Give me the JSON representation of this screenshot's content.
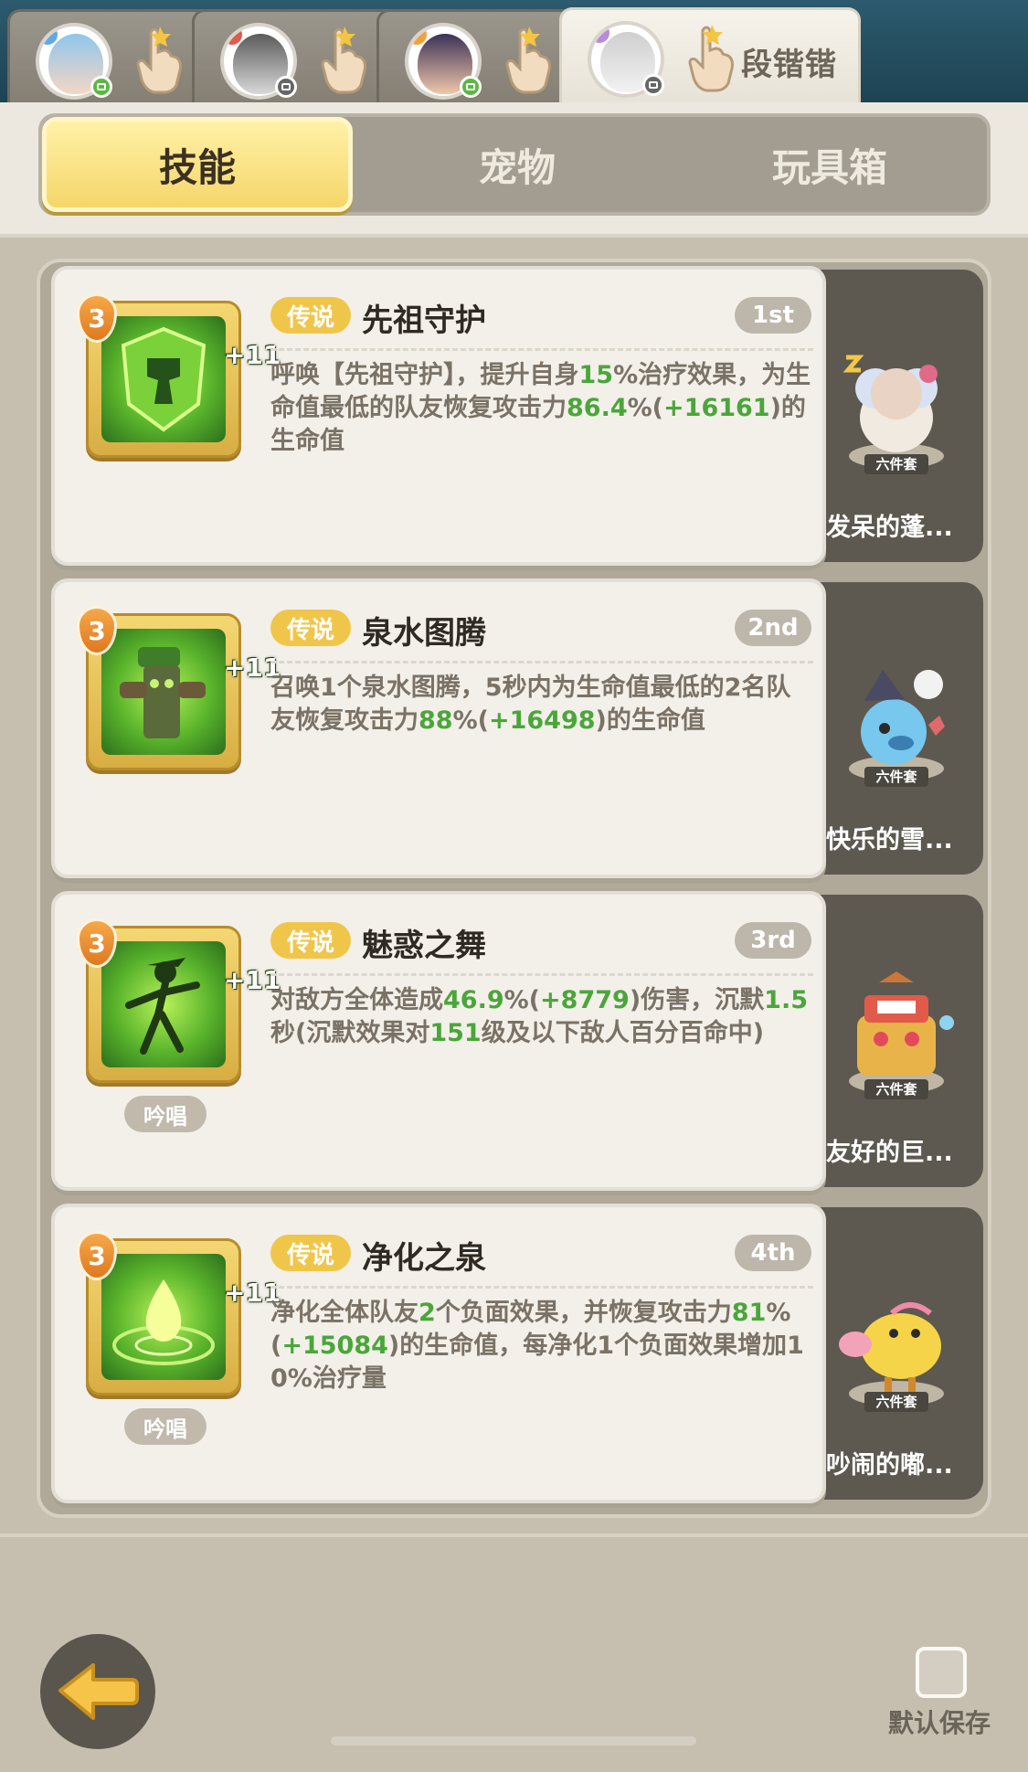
{
  "hero_tabs": [
    {
      "name": "",
      "active": false
    },
    {
      "name": "",
      "active": false
    },
    {
      "name": "",
      "active": false
    },
    {
      "name": "段锴锴",
      "active": true
    }
  ],
  "category_tabs": [
    {
      "label": "技能",
      "active": true
    },
    {
      "label": "宠物",
      "active": false
    },
    {
      "label": "玩具箱",
      "active": false
    }
  ],
  "skills": [
    {
      "level": "3",
      "plus": "+11",
      "rarity": "传说",
      "name": "先祖守护",
      "order": "1st",
      "chant": "",
      "desc": [
        {
          "t": "呼唤【先祖守护】，提升自身"
        },
        {
          "t": "15",
          "hl": true
        },
        {
          "t": "%治疗效果，为生命值最低的队友恢复攻击力"
        },
        {
          "t": "86.4",
          "hl": true
        },
        {
          "t": "%("
        },
        {
          "t": "+16161",
          "hl": true
        },
        {
          "t": ")的生命值"
        }
      ],
      "pet": {
        "set": "六件套",
        "name": "发呆的蓬..."
      }
    },
    {
      "level": "3",
      "plus": "+11",
      "rarity": "传说",
      "name": "泉水图腾",
      "order": "2nd",
      "chant": "",
      "desc": [
        {
          "t": "召唤1个泉水图腾，5秒内为生命值最低的2名队友恢复攻击力"
        },
        {
          "t": "88",
          "hl": true
        },
        {
          "t": "%("
        },
        {
          "t": "+16498",
          "hl": true
        },
        {
          "t": ")的生命值"
        }
      ],
      "pet": {
        "set": "六件套",
        "name": "快乐的雪..."
      }
    },
    {
      "level": "3",
      "plus": "+11",
      "rarity": "传说",
      "name": "魅惑之舞",
      "order": "3rd",
      "chant": "吟唱",
      "desc": [
        {
          "t": "对敌方全体造成"
        },
        {
          "t": "46.9",
          "hl": true
        },
        {
          "t": "%("
        },
        {
          "t": "+8779",
          "hl": true
        },
        {
          "t": ")伤害，沉默"
        },
        {
          "t": "1.5",
          "hl": true
        },
        {
          "t": "秒(沉默效果对"
        },
        {
          "t": "151",
          "hl": true
        },
        {
          "t": "级及以下敌人百分百命中)"
        }
      ],
      "pet": {
        "set": "六件套",
        "name": "友好的巨..."
      }
    },
    {
      "level": "3",
      "plus": "+11",
      "rarity": "传说",
      "name": "净化之泉",
      "order": "4th",
      "chant": "吟唱",
      "desc": [
        {
          "t": "净化全体队友"
        },
        {
          "t": "2",
          "hl": true
        },
        {
          "t": "个负面效果，并恢复攻击力"
        },
        {
          "t": "81",
          "hl": true
        },
        {
          "t": "%("
        },
        {
          "t": "+15084",
          "hl": true
        },
        {
          "t": ")的生命值，每净化1个负面效果增加10%治疗量"
        }
      ],
      "pet": {
        "set": "六件套",
        "name": "吵闹的嘟..."
      }
    }
  ],
  "bottom": {
    "save_label": "默认保存"
  },
  "colors": {
    "highlight": "#4aa63a",
    "rarity_bg": "#f0c64a",
    "active_tab": "#f6d66a"
  }
}
